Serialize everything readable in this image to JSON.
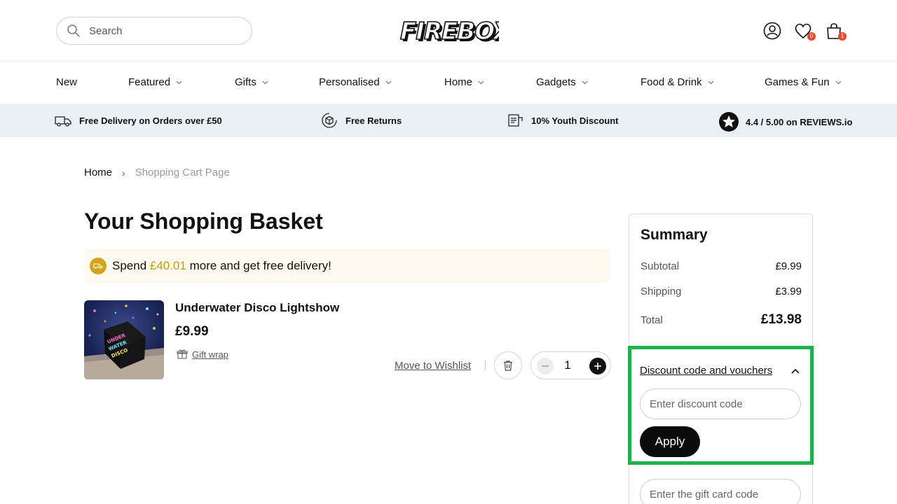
{
  "header": {
    "search_placeholder": "Search",
    "logo_text": "FIREBOX",
    "wishlist_count": "0",
    "cart_count": "1"
  },
  "nav": {
    "items": [
      {
        "label": "New",
        "has_dropdown": false
      },
      {
        "label": "Featured",
        "has_dropdown": true
      },
      {
        "label": "Gifts",
        "has_dropdown": true
      },
      {
        "label": "Personalised",
        "has_dropdown": true
      },
      {
        "label": "Home",
        "has_dropdown": true
      },
      {
        "label": "Gadgets",
        "has_dropdown": true
      },
      {
        "label": "Food & Drink",
        "has_dropdown": true
      },
      {
        "label": "Games & Fun",
        "has_dropdown": true
      }
    ]
  },
  "perks": [
    {
      "label": "Free Delivery on Orders over £50",
      "icon": "delivery-truck-icon"
    },
    {
      "label": "Free Returns",
      "icon": "returns-box-icon"
    },
    {
      "label": "10% Youth Discount",
      "icon": "student-card-icon"
    },
    {
      "label": "4.4 / 5.00 on REVIEWS.io",
      "icon": "star-badge-icon"
    }
  ],
  "breadcrumb": {
    "home": "Home",
    "separator": "›",
    "current": "Shopping Cart Page"
  },
  "main": {
    "title": "Your Shopping Basket",
    "banner": {
      "prefix": "Spend ",
      "amount": "£40.01",
      "suffix": " more and get free delivery!"
    },
    "product": {
      "name": "Underwater Disco Lightshow",
      "price": "£9.99",
      "gift_wrap": "Gift wrap",
      "move_to_wishlist": "Move to Wishlist",
      "quantity": "1"
    }
  },
  "summary": {
    "title": "Summary",
    "subtotal_label": "Subtotal",
    "subtotal_value": "£9.99",
    "shipping_label": "Shipping",
    "shipping_value": "£3.99",
    "total_label": "Total",
    "total_value": "£13.98",
    "discount_heading": "Discount code and vouchers",
    "discount_placeholder": "Enter discount code",
    "apply_label": "Apply",
    "gift_card_placeholder": "Enter the gift card code"
  },
  "colors": {
    "accent_green": "#20b34d",
    "banner_gold": "#c99a10",
    "perks_bg": "#e9f1f5",
    "badge_red": "#e8472b"
  }
}
